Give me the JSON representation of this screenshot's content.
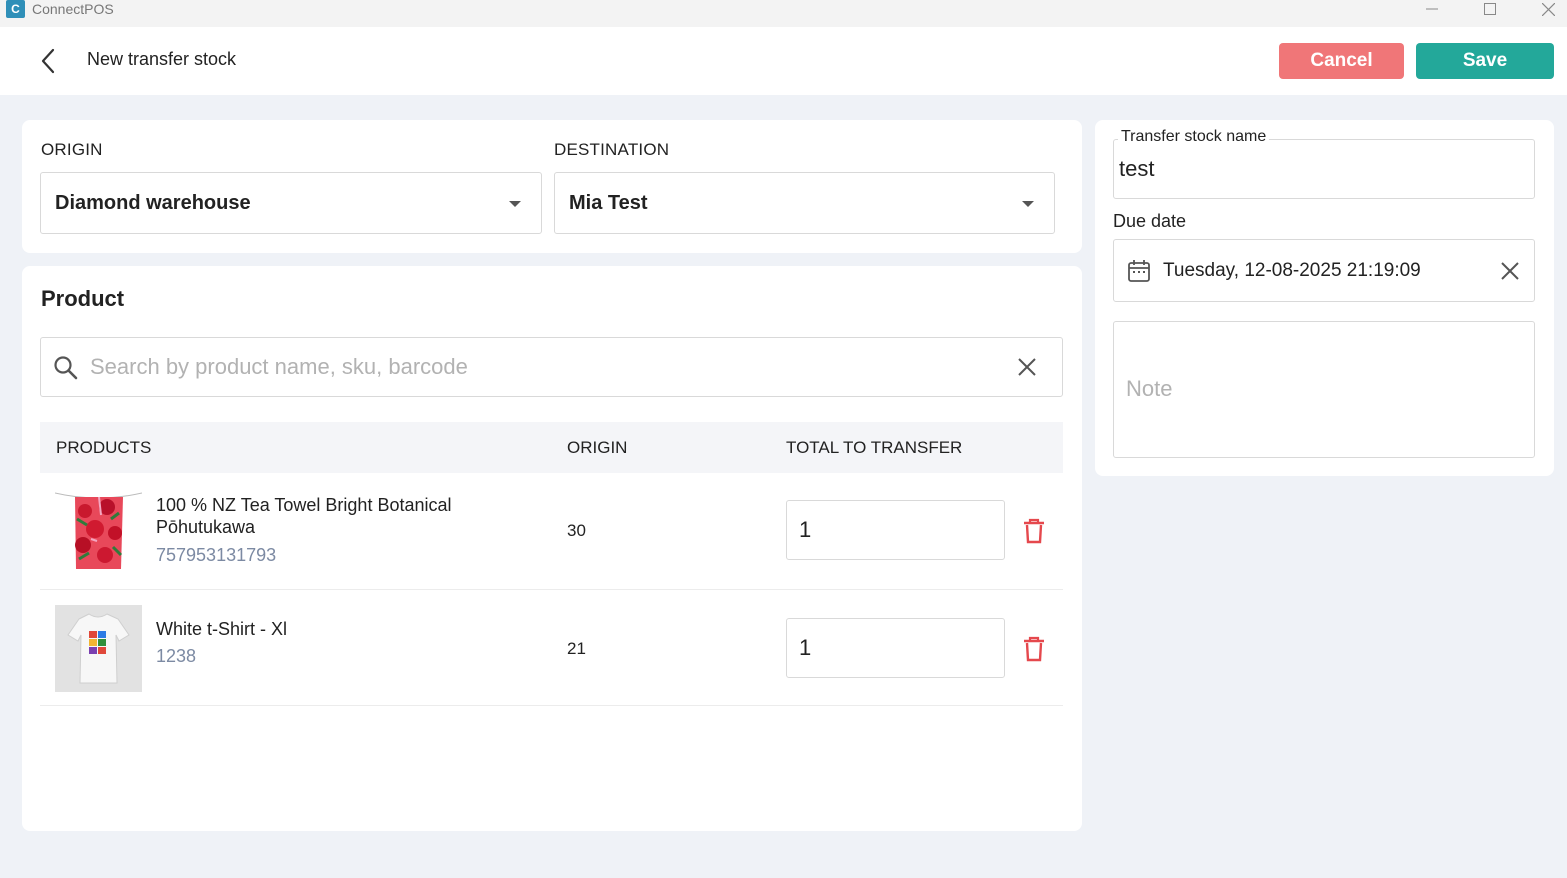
{
  "titlebar": {
    "app_name": "ConnectPOS",
    "logo_glyph": "C"
  },
  "header": {
    "title": "New transfer stock",
    "cancel_label": "Cancel",
    "save_label": "Save"
  },
  "origin_dest": {
    "origin_label": "ORIGIN",
    "origin_value": "Diamond warehouse",
    "destination_label": "DESTINATION",
    "destination_value": "Mia Test"
  },
  "product": {
    "heading": "Product",
    "search_placeholder": "Search by product name, sku, barcode",
    "columns": [
      "PRODUCTS",
      "ORIGIN",
      "TOTAL TO TRANSFER"
    ],
    "rows": [
      {
        "name": "100 % NZ Tea Towel Bright Botanical Pōhutukawa",
        "sku": "757953131793",
        "origin": "30",
        "qty": "1"
      },
      {
        "name": "White t-Shirt - Xl",
        "sku": "1238",
        "origin": "21",
        "qty": "1"
      }
    ]
  },
  "side": {
    "name_label": "Transfer stock name",
    "name_value": "test",
    "due_label": "Due date",
    "due_value": "Tuesday, 12-08-2025 21:19:09",
    "note_placeholder": "Note"
  },
  "colors": {
    "cancel": "#f07678",
    "save": "#23a89a",
    "delete": "#e5484d",
    "sku": "#7c8aa3",
    "background": "#eff2f7"
  }
}
